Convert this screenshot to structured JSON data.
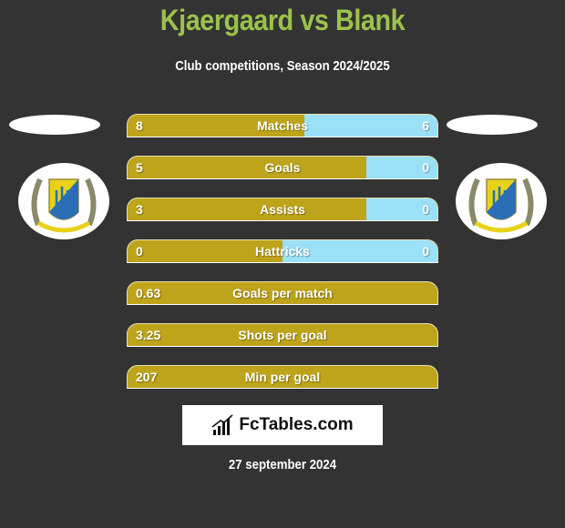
{
  "header": {
    "title": "Kjaergaard vs Blank",
    "subtitle": "Club competitions, Season 2024/2025"
  },
  "players": {
    "left": {
      "name": "Kjaergaard",
      "badge_icon": "club-crest-icon"
    },
    "right": {
      "name": "Blank",
      "badge_icon": "club-crest-icon"
    }
  },
  "colors": {
    "title": "#9bc24b",
    "left_bar": "#bda41b",
    "right_bar": "#9ae0f7",
    "background": "#333333"
  },
  "stats": [
    {
      "label": "Matches",
      "left": "8",
      "right": "6",
      "left_share": 0.57
    },
    {
      "label": "Goals",
      "left": "5",
      "right": "0",
      "left_share": 0.77
    },
    {
      "label": "Assists",
      "left": "3",
      "right": "0",
      "left_share": 0.77
    },
    {
      "label": "Hattricks",
      "left": "0",
      "right": "0",
      "left_share": 0.5
    },
    {
      "label": "Goals per match",
      "left": "0.63",
      "right": null,
      "left_share": 1.0
    },
    {
      "label": "Shots per goal",
      "left": "3.25",
      "right": null,
      "left_share": 1.0
    },
    {
      "label": "Min per goal",
      "left": "207",
      "right": null,
      "left_share": 1.0
    }
  ],
  "footer": {
    "logo_text": "FcTables.com",
    "logo_icon": "bar-chart-icon",
    "date": "27 september 2024"
  }
}
